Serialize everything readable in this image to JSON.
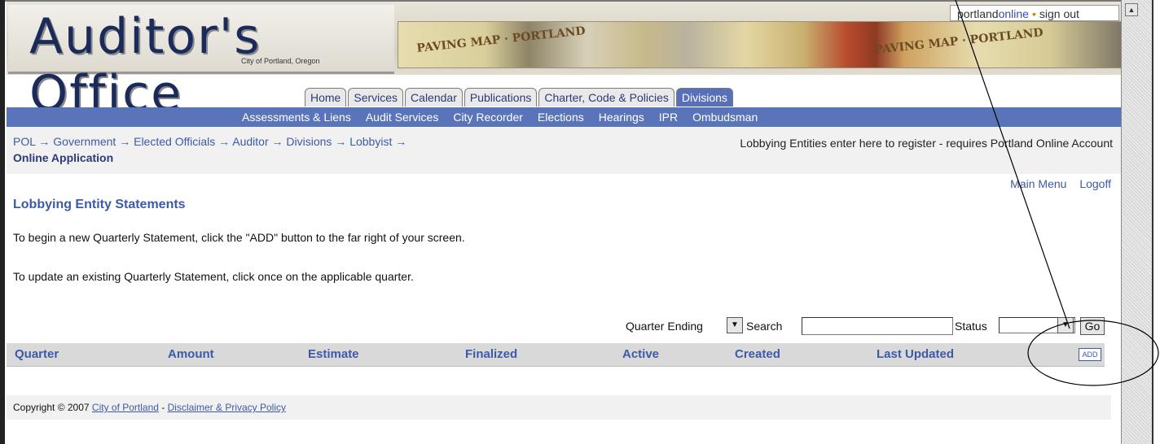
{
  "header": {
    "logo_title": "Auditor's Office",
    "logo_subtitle": "City of Portland, Oregon",
    "collage_text_left": "PAVING MAP · PORTLAND",
    "collage_text_right": "PAVING MAP · PORTLAND",
    "portal_prefix": "portland",
    "portal_suffix": "online",
    "sign_out": "sign out"
  },
  "tabs": [
    {
      "label": "Home"
    },
    {
      "label": "Services"
    },
    {
      "label": "Calendar"
    },
    {
      "label": "Publications"
    },
    {
      "label": "Charter, Code & Policies"
    },
    {
      "label": "Divisions",
      "active": true
    }
  ],
  "subnav": [
    {
      "label": "Assessments & Liens"
    },
    {
      "label": "Audit Services"
    },
    {
      "label": "City Recorder"
    },
    {
      "label": "Elections"
    },
    {
      "label": "Hearings"
    },
    {
      "label": "IPR"
    },
    {
      "label": "Ombudsman"
    }
  ],
  "breadcrumb": {
    "items": [
      "POL",
      "Government",
      "Elected Officials",
      "Auditor",
      "Divisions",
      "Lobbyist"
    ],
    "separator": "→",
    "current": "Online Application",
    "register_text": "Lobbying Entities enter here to register - requires Portland Online Account"
  },
  "menu_links": {
    "main_menu": "Main Menu",
    "logoff": "Logoff"
  },
  "page": {
    "title": "Lobbying Entity Statements",
    "instruction_1": "To begin a new Quarterly Statement, click the \"ADD\" button to the far right of your screen.",
    "instruction_2": "To update an existing Quarterly Statement, click once on the applicable quarter."
  },
  "filter": {
    "quarter_label": "Quarter Ending",
    "search_label": "Search",
    "search_value": "",
    "status_label": "Status",
    "status_value": "",
    "go_label": "Go"
  },
  "table": {
    "columns": [
      "Quarter",
      "Amount",
      "Estimate",
      "Finalized",
      "Active",
      "Created",
      "Last Updated"
    ],
    "add_label": "ADD",
    "rows": []
  },
  "footer": {
    "copyright": "Copyright © 2007",
    "city_link": "City of Portland",
    "separator": "-",
    "disclaimer_link": "Disclaimer & Privacy Policy"
  },
  "colors": {
    "nav_blue": "#5a74b9",
    "link_blue": "#3d5aa6",
    "orange_dot": "#e57a00"
  }
}
